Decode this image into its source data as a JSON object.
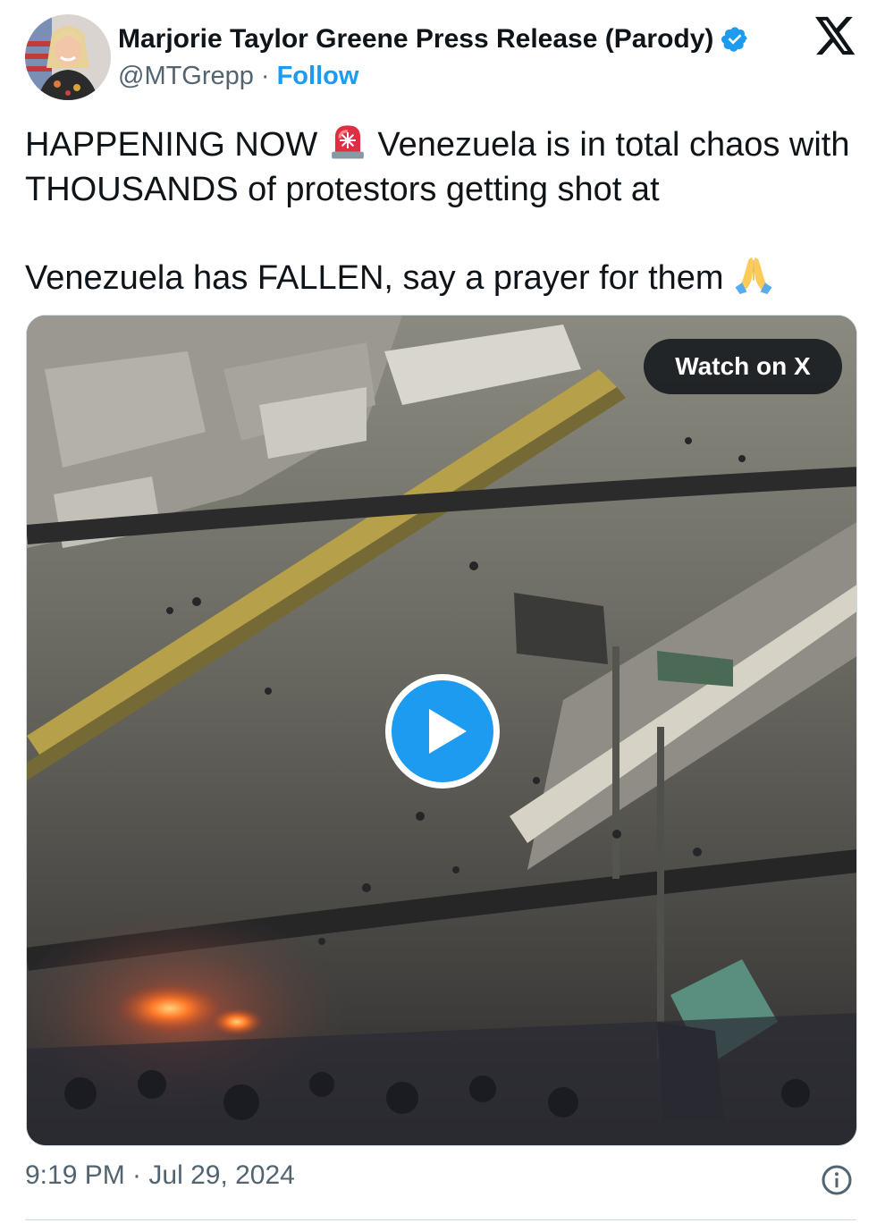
{
  "author": {
    "display_name": "Marjorie Taylor Greene Press Release (Parody)",
    "handle": "@MTGrepp",
    "separator": "·",
    "follow_label": "Follow",
    "avatar_icon": "profile-photo",
    "verified_icon": "verified-badge-icon"
  },
  "tweet": {
    "line1_before_emoji": "HAPPENING NOW ",
    "line1_emoji": "police-light-emoji",
    "line1_after_emoji": " Venezuela is in total chaos with THOUSANDS of protestors getting shot at",
    "line2_before_emoji": "Venezuela has FALLEN, say a prayer for them ",
    "line2_emoji": "folded-hands-emoji"
  },
  "media": {
    "type": "video",
    "watch_label": "Watch on X",
    "play_icon": "play-icon"
  },
  "footer": {
    "timestamp": "9:19 PM · Jul 29, 2024",
    "info_icon": "info-icon"
  },
  "colors": {
    "accent": "#1d9bf0",
    "text": "#0f1419",
    "secondary_text": "#536471",
    "border": "#cfd9de"
  }
}
